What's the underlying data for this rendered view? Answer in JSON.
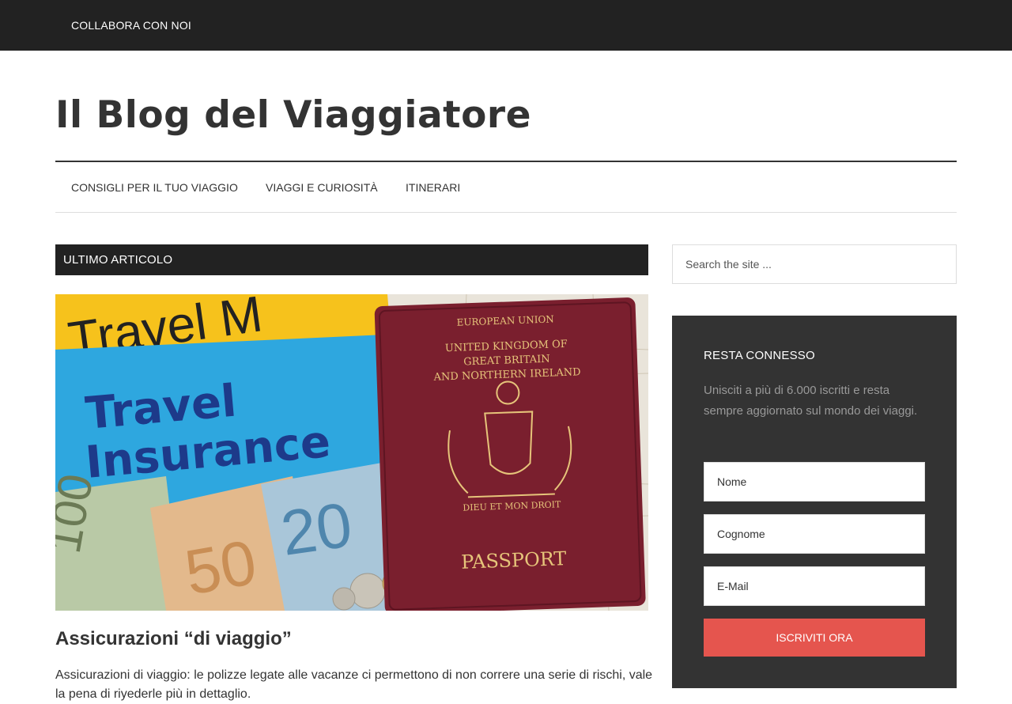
{
  "topbar": {
    "link_label": "COLLABORA CON NOI"
  },
  "site": {
    "title": "Il Blog del Viaggiatore"
  },
  "nav": {
    "items": [
      {
        "label": "CONSIGLI PER IL TUO VIAGGIO"
      },
      {
        "label": "VIAGGI E CURIOSITÀ"
      },
      {
        "label": "ITINERARI"
      }
    ]
  },
  "main": {
    "section_title": "ULTIMO ARTICOLO",
    "post": {
      "image_text": {
        "folder_top": "Travel M",
        "folder_line1": "Travel",
        "folder_line2": "Insurance",
        "passport_union": "EUROPEAN UNION",
        "passport_country_1": "UNITED KINGDOM OF",
        "passport_country_2": "GREAT BRITAIN",
        "passport_country_3": "AND NORTHERN IRELAND",
        "passport_label": "PASSPORT",
        "motto": "DIEU ET MON DROIT",
        "note_100": "100",
        "note_50": "50",
        "note_20": "20"
      },
      "title": "Assicurazioni “di viaggio”",
      "excerpt": "Assicurazioni di viaggio: le polizze legate alle vacanze ci permettono di non correre una serie di rischi, vale la pena di riyederle più in dettaglio."
    }
  },
  "sidebar": {
    "search": {
      "placeholder": "Search the site ..."
    },
    "newsletter": {
      "title": "RESTA CONNESSO",
      "text": "Unisciti a più di 6.000 iscritti e resta sempre aggiornato sul mondo dei viaggi.",
      "first_name_placeholder": "Nome",
      "last_name_placeholder": "Cognome",
      "email_placeholder": "E-Mail",
      "button_label": "ISCRIVITI ORA"
    }
  },
  "colors": {
    "topbar_bg": "#222222",
    "newsletter_bg": "#333333",
    "button_bg": "#e5554e",
    "passport": "#7a1f2e",
    "folder_yellow": "#f6c21c",
    "folder_blue": "#2ea7df"
  }
}
